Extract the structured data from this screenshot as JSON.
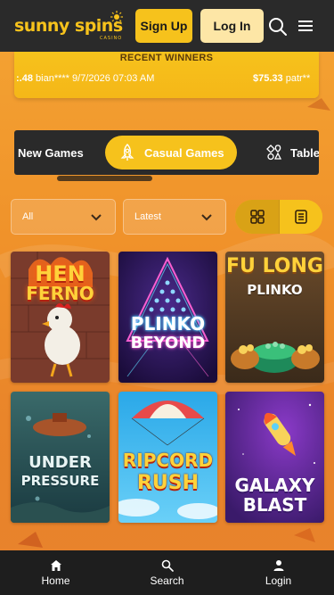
{
  "header": {
    "logo_text": "sunny spins",
    "logo_sub": "CASINO",
    "signup_label": "Sign Up",
    "login_label": "Log In",
    "icons": [
      "search-icon",
      "menu-icon"
    ]
  },
  "winners": {
    "title": "RECENT WINNERS",
    "items": [
      {
        "amount": ":.48",
        "user": "bian****",
        "time": "9/7/2026 07:03 AM"
      },
      {
        "amount": "$75.33",
        "user": "patr**",
        "time": ""
      }
    ]
  },
  "categories": {
    "tabs": [
      {
        "label": "New Games",
        "icon": "",
        "active": false
      },
      {
        "label": "Casual Games",
        "icon": "rocket-icon",
        "active": true
      },
      {
        "label": "Table",
        "icon": "cards-icon",
        "active": false
      }
    ]
  },
  "filters": {
    "provider_value": "All",
    "sort_value": "Latest",
    "view_modes": [
      "grid-view-icon",
      "list-view-icon"
    ],
    "active_view": "grid"
  },
  "games": [
    {
      "title_line1": "HEN",
      "title_line2": "FERNO"
    },
    {
      "title_line1": "PLINKO",
      "title_line2": "BEYOND"
    },
    {
      "title_line1": "FU LONG",
      "title_line2": "PLINKO"
    },
    {
      "title_line1": "UNDER",
      "title_line2": "PRESSURE"
    },
    {
      "title_line1": "RIPCORD",
      "title_line2": "RUSH"
    },
    {
      "title_line1": "GALAXY",
      "title_line2": "BLAST"
    }
  ],
  "bottom_nav": {
    "items": [
      {
        "label": "Home",
        "icon": "home-icon"
      },
      {
        "label": "Search",
        "icon": "search-icon"
      },
      {
        "label": "Login",
        "icon": "user-icon"
      }
    ]
  },
  "colors": {
    "accent": "#f6c21c",
    "header_bg": "#2a2a2a",
    "page_bg": "#f0922a"
  }
}
